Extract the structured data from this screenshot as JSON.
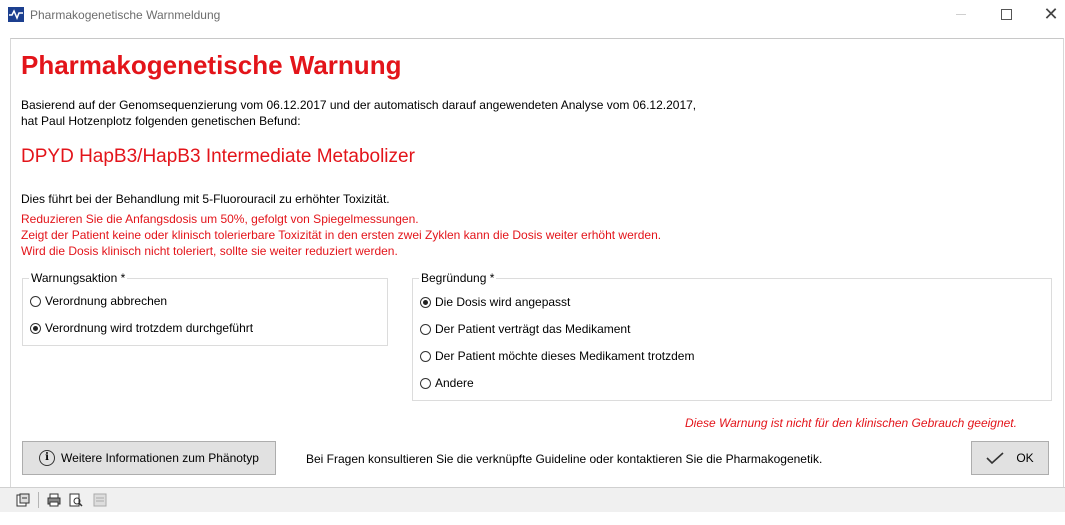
{
  "window": {
    "title": "Pharmakogenetische Warnmeldung",
    "icon": "waveform-app-icon",
    "controls": {
      "minimize": "minimize-icon",
      "maximize": "maximize-icon",
      "close": "✕"
    }
  },
  "warning": {
    "heading": "Pharmakogenetische Warnung",
    "intro_line1": "Basierend auf der Genomsequenzierung vom 06.12.2017 und der automatisch darauf angewendeten Analyse vom 06.12.2017,",
    "intro_line2": "hat Paul Hotzenplotz folgenden genetischen Befund:",
    "finding": "DPYD HapB3/HapB3 Intermediate Metabolizer",
    "effect": "Dies führt bei der Behandlung mit 5-Fluorouracil zu erhöhter Toxizität.",
    "recommendation_line1": "Reduzieren Sie die Anfangsdosis um 50%, gefolgt von Spiegelmessungen.",
    "recommendation_line2": "Zeigt der Patient keine oder klinisch tolerierbare Toxizität in den ersten zwei Zyklen kann die Dosis weiter erhöht werden.",
    "recommendation_line3": "Wird die Dosis klinisch nicht toleriert, sollte sie weiter reduziert werden.",
    "accent_color": "#e3141a"
  },
  "action_group": {
    "label": "Warnungsaktion *",
    "options": [
      {
        "label": "Verordnung abbrechen",
        "checked": false
      },
      {
        "label": "Verordnung wird trotzdem durchgeführt",
        "checked": true
      }
    ]
  },
  "reason_group": {
    "label": "Begründung *",
    "options": [
      {
        "label": "Die Dosis wird angepasst",
        "checked": true
      },
      {
        "label": "Der Patient verträgt das Medikament",
        "checked": false
      },
      {
        "label": "Der Patient möchte dieses Medikament trotzdem",
        "checked": false
      },
      {
        "label": "Andere",
        "checked": false
      }
    ]
  },
  "disclaimer": "Diese Warnung ist nicht für den klinischen Gebrauch geeignet.",
  "footer": {
    "info_button": "Weitere Informationen zum Phänotyp",
    "note": "Bei Fragen konsultieren Sie die verknüpfte Guideline oder kontaktieren Sie die Pharmakogenetik.",
    "ok_button": "OK"
  },
  "statusbar": {
    "icons": [
      "export-icon",
      "print-icon",
      "print-preview-icon",
      "settings-disabled-icon"
    ]
  }
}
